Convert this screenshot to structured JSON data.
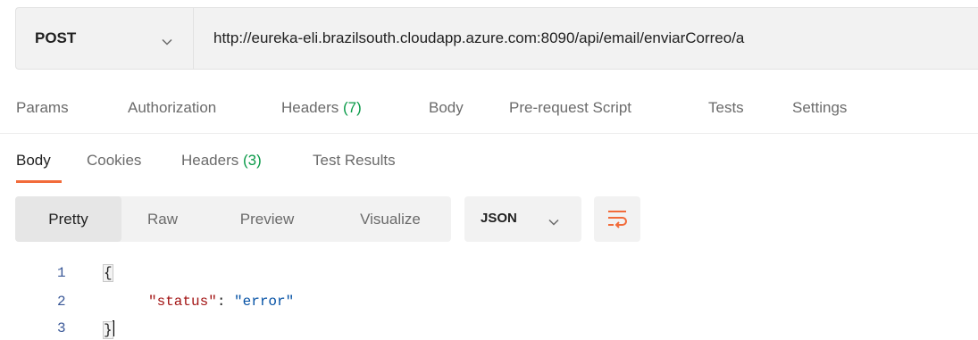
{
  "request": {
    "method": "POST",
    "url": "http://eureka-eli.brazilsouth.cloudapp.azure.com:8090/api/email/enviarCorreo/a"
  },
  "request_tabs": [
    {
      "label": "Params",
      "count": ""
    },
    {
      "label": "Authorization",
      "count": ""
    },
    {
      "label": "Headers",
      "count": "(7)"
    },
    {
      "label": "Body",
      "count": ""
    },
    {
      "label": "Pre-request Script",
      "count": ""
    },
    {
      "label": "Tests",
      "count": ""
    },
    {
      "label": "Settings",
      "count": ""
    }
  ],
  "response_tabs": [
    {
      "label": "Body",
      "count": ""
    },
    {
      "label": "Cookies",
      "count": ""
    },
    {
      "label": "Headers",
      "count": "(3)"
    },
    {
      "label": "Test Results",
      "count": ""
    }
  ],
  "view_modes": [
    "Pretty",
    "Raw",
    "Preview",
    "Visualize"
  ],
  "format": "JSON",
  "code": {
    "lines": [
      "1",
      "2",
      "3"
    ],
    "open_brace": "{",
    "key": "\"status\"",
    "colon": ": ",
    "value": "\"error\"",
    "close_brace": "}"
  },
  "colors": {
    "accent": "#f26b3a",
    "count_green": "#0c9b4a",
    "json_key": "#a31515",
    "json_string": "#0451a5"
  },
  "icons": {
    "method_dropdown": "chevron-down-icon",
    "format_dropdown": "chevron-down-icon",
    "wrap": "wrap-text-icon"
  }
}
